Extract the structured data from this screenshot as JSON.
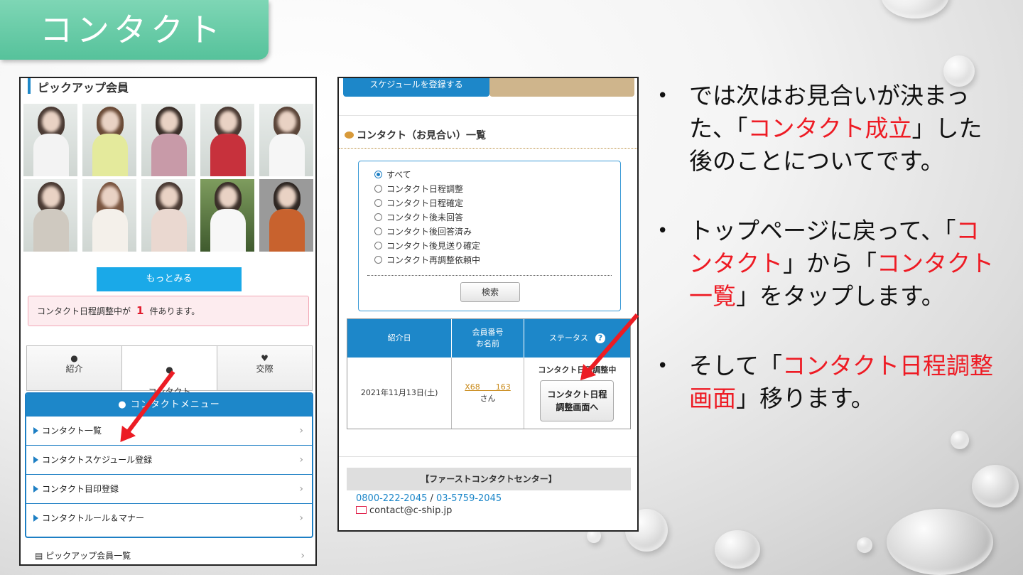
{
  "slide": {
    "title": "コンタクト",
    "bullets": [
      {
        "parts": [
          {
            "t": "では次はお見合いが決まった、「",
            "red": false
          },
          {
            "t": "コンタクト成立",
            "red": true
          },
          {
            "t": "」した後のことについてです。",
            "red": false
          }
        ]
      },
      {
        "parts": [
          {
            "t": "トップページに戻って、「",
            "red": false
          },
          {
            "t": "コンタクト",
            "red": true
          },
          {
            "t": "」から「",
            "red": false
          },
          {
            "t": "コンタクト一覧",
            "red": true
          },
          {
            "t": "」をタップします。",
            "red": false
          }
        ]
      },
      {
        "parts": [
          {
            "t": "そして「",
            "red": false
          },
          {
            "t": "コンタクト日程調整画面",
            "red": true
          },
          {
            "t": "」移ります。",
            "red": false
          }
        ]
      }
    ],
    "colors": {
      "accent_red": "#ee1b24",
      "tab_green": "#56c29b",
      "app_blue": "#1d87c9"
    }
  },
  "left": {
    "header": "ピックアップ会員",
    "more_button": "もっとみる",
    "notice": {
      "prefix": "コンタクト日程調整中が",
      "count": "1",
      "suffix": "件あります。"
    },
    "tabs": [
      {
        "icon": "user-icon",
        "glyph": "👤",
        "label": "紹介"
      },
      {
        "icon": "speech-bubble-icon",
        "glyph": "💬",
        "label": "コンタクト\n(お見合い)"
      },
      {
        "icon": "heart-icon",
        "glyph": "♥",
        "label": "交際"
      }
    ],
    "menu_title": "コンタクトメニュー",
    "menu_items": [
      "コンタクト一覧",
      "コンタクトスケジュール登録",
      "コンタクト目印登録",
      "コンタクトルール＆マナー"
    ],
    "bottom_item": "ピックアップ会員一覧"
  },
  "middle": {
    "top_button": "スケジュールを登録する",
    "title": "コンタクト（お見合い）一覧",
    "filters": [
      {
        "label": "すべて",
        "selected": true
      },
      {
        "label": "コンタクト日程調整",
        "selected": false
      },
      {
        "label": "コンタクト日程確定",
        "selected": false
      },
      {
        "label": "コンタクト後未回答",
        "selected": false
      },
      {
        "label": "コンタクト後回答済み",
        "selected": false
      },
      {
        "label": "コンタクト後見送り確定",
        "selected": false
      },
      {
        "label": "コンタクト再調整依頼中",
        "selected": false
      }
    ],
    "search_button": "検索",
    "table": {
      "headers": {
        "date": "紹介日",
        "member": "会員番号\nお名前",
        "status": "ステータス"
      },
      "row": {
        "date": "2021年11月13日(土)",
        "member_no": "X68　　163",
        "member_suffix": "さん",
        "status": "コンタクト日程調整中",
        "button": "コンタクト日程\n調整画面へ"
      }
    },
    "first_contact": {
      "title": "【ファーストコンタクトセンター】",
      "phone1": "0800-222-2045",
      "phone_sep": " / ",
      "phone2": "03-5759-2045",
      "email": "contact@c-ship.jp"
    }
  }
}
